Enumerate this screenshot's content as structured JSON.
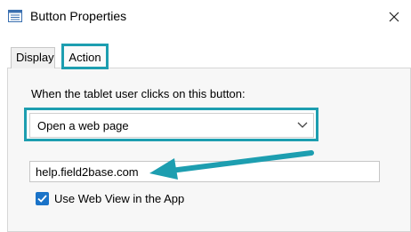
{
  "window": {
    "title": "Button Properties",
    "icon": "table-form-icon",
    "close_icon": "close-icon"
  },
  "tabs": [
    {
      "label": "Display",
      "selected": false
    },
    {
      "label": "Action",
      "selected": true
    }
  ],
  "action": {
    "prompt": "When the tablet user clicks on this button:",
    "selected_action": "Open a web page",
    "url_value": "help.field2base.com",
    "webview_label": "Use Web View in the App",
    "webview_checked": true
  },
  "colors": {
    "highlight": "#1d9eb0",
    "arrow": "#1d9eb0",
    "checkbox": "#1a73c8"
  }
}
